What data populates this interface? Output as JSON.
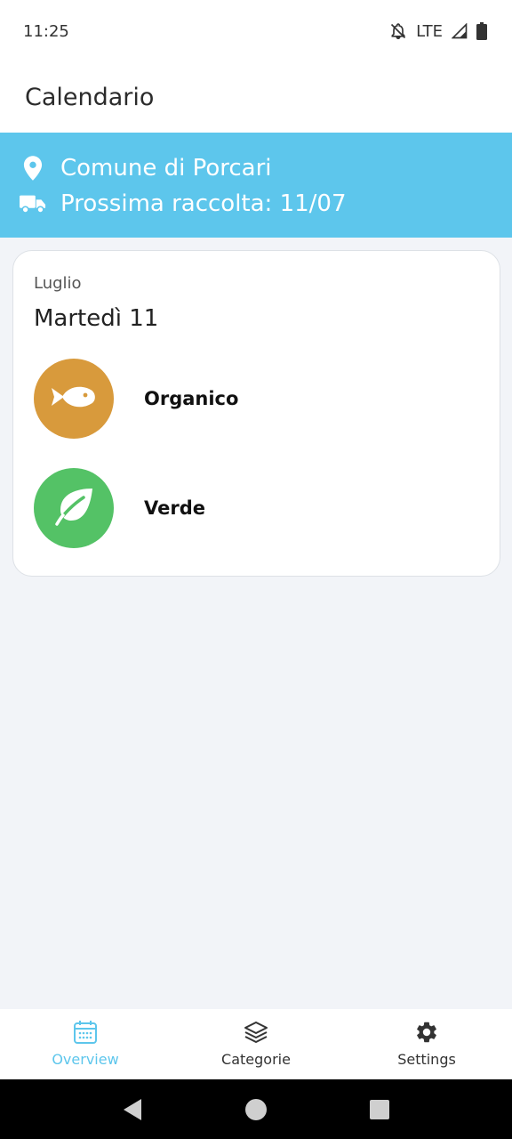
{
  "status_bar": {
    "time": "11:25",
    "network": "LTE",
    "icons": [
      "notifications-off-icon",
      "signal-icon",
      "battery-icon"
    ]
  },
  "app_bar": {
    "title": "Calendario"
  },
  "banner": {
    "color": "#5dc6ec",
    "location_icon": "location-pin-icon",
    "location": "Comune di Porcari",
    "truck_icon": "truck-icon",
    "next_collection": "Prossima raccolta: 11/07"
  },
  "card": {
    "month": "Luglio",
    "day": "Martedì 11",
    "items": [
      {
        "label": "Organico",
        "icon": "fish-icon",
        "color": "#d89a3c"
      },
      {
        "label": "Verde",
        "icon": "leaf-icon",
        "color": "#54c266"
      }
    ]
  },
  "bottom_nav": {
    "accent": "#5dc6ec",
    "items": [
      {
        "label": "Overview",
        "icon": "calendar-icon",
        "active": true
      },
      {
        "label": "Categorie",
        "icon": "layers-icon",
        "active": false
      },
      {
        "label": "Settings",
        "icon": "gear-icon",
        "active": false
      }
    ]
  },
  "system_nav": {
    "buttons": [
      "back-icon",
      "home-icon",
      "recents-icon"
    ]
  }
}
